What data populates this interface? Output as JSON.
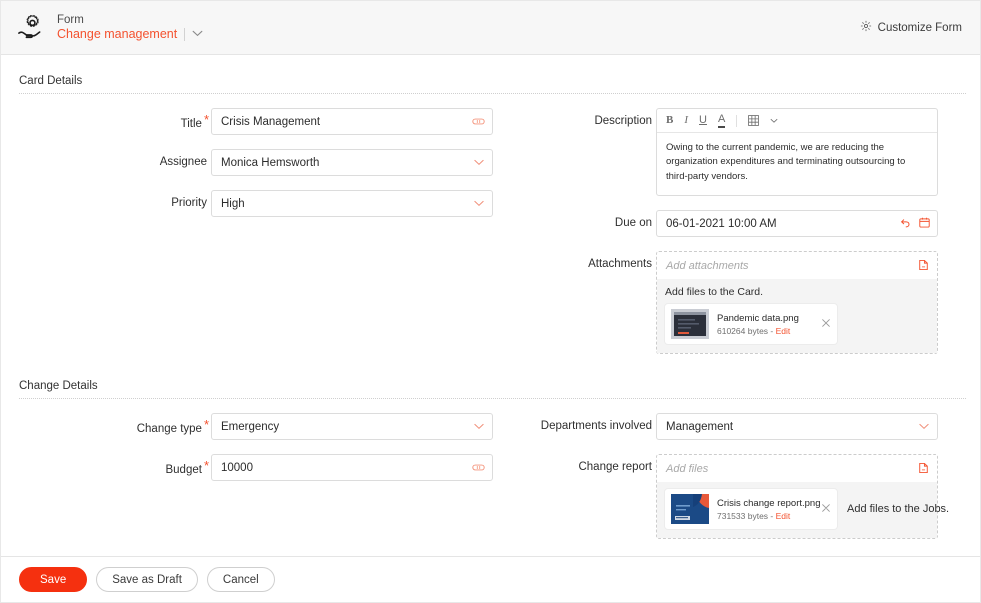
{
  "header": {
    "app_icon": "gear-in-hand-icon",
    "kicker": "Form",
    "form_name": "Change management",
    "dropdown_icon": "chevron-down-icon",
    "customize_label": "Customize Form",
    "customize_icon": "gear-icon"
  },
  "sections": {
    "card_details": {
      "title": "Card Details",
      "title_field": {
        "label": "Title",
        "required": true,
        "value": "Crisis Management",
        "trailing_icon": "eraser-icon"
      },
      "assignee": {
        "label": "Assignee",
        "required": false,
        "value": "Monica Hemsworth",
        "trailing_icon": "chevron-down-icon"
      },
      "priority": {
        "label": "Priority",
        "required": false,
        "value": "High",
        "trailing_icon": "chevron-down-icon"
      },
      "description": {
        "label": "Description",
        "toolbar": [
          "B",
          "I",
          "U",
          "A",
          "table-icon",
          "chevron-down-icon"
        ],
        "value": "Owing to the current pandemic, we are reducing the organization expenditures and terminating outsourcing to third-party vendors."
      },
      "due_on": {
        "label": "Due on",
        "value": "06-01-2021 10:00 AM",
        "icons": [
          "undo-icon",
          "calendar-icon"
        ]
      },
      "attachments": {
        "label": "Attachments",
        "placeholder": "Add attachments",
        "upload_icon": "upload-file-icon",
        "hint": "Add files to the Card.",
        "files": [
          {
            "name": "Pandemic data.png",
            "size": "610264 bytes",
            "separator": "-",
            "edit_label": "Edit",
            "thumbnail": "dark-screenshot-thumbnail",
            "remove_icon": "close-icon"
          }
        ]
      }
    },
    "change_details": {
      "title": "Change Details",
      "change_type": {
        "label": "Change type",
        "required": true,
        "value": "Emergency",
        "trailing_icon": "chevron-down-icon"
      },
      "budget": {
        "label": "Budget",
        "required": true,
        "value": "10000",
        "trailing_icon": "eraser-icon"
      },
      "departments": {
        "label": "Departments involved",
        "required": false,
        "value": "Management",
        "trailing_icon": "chevron-down-icon"
      },
      "change_report": {
        "label": "Change report",
        "placeholder": "Add files",
        "upload_icon": "upload-file-icon",
        "hint": "Add files to the Jobs.",
        "files": [
          {
            "name": "Crisis change report.png",
            "size": "731533 bytes",
            "separator": "-",
            "edit_label": "Edit",
            "thumbnail": "blue-document-thumbnail",
            "remove_icon": "close-icon"
          }
        ]
      }
    }
  },
  "footer": {
    "save": "Save",
    "save_draft": "Save as Draft",
    "cancel": "Cancel"
  },
  "colors": {
    "accent": "#f5300f",
    "link": "#f4522f",
    "muted_accent": "#f08e78",
    "header_bg": "#f7f7f7",
    "panel_bg": "#f4f4f4"
  }
}
